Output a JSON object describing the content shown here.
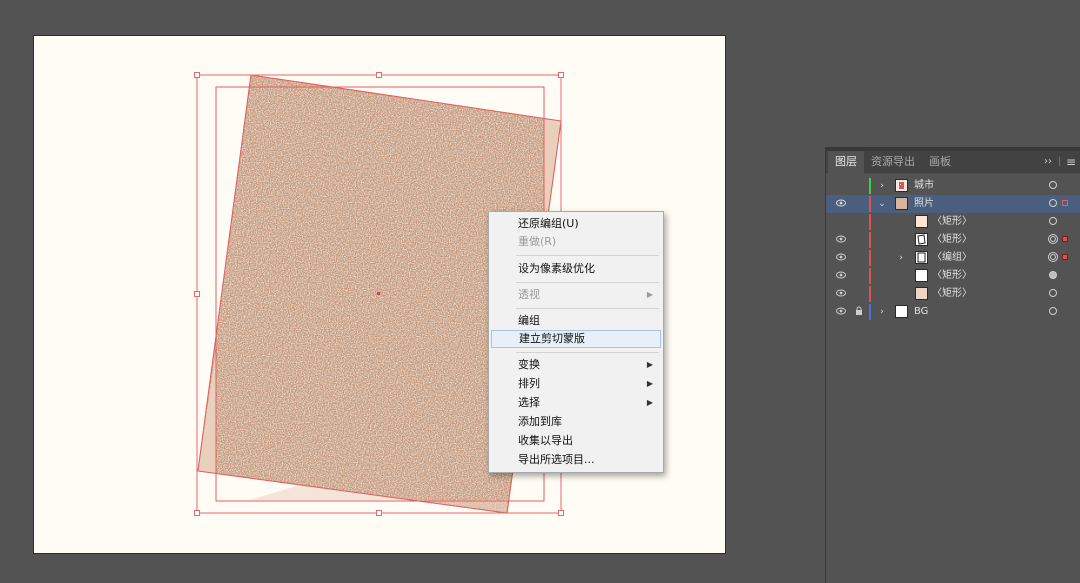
{
  "context_menu": {
    "items": [
      {
        "label": "还原编组(U)",
        "disabled": false,
        "submenu": false
      },
      {
        "label": "重做(R)",
        "disabled": true,
        "submenu": false
      },
      {
        "label": "设为像素级优化",
        "disabled": false,
        "submenu": false
      },
      {
        "label": "透视",
        "disabled": true,
        "submenu": true
      },
      {
        "label": "编组",
        "disabled": false,
        "submenu": false
      },
      {
        "label": "建立剪切蒙版",
        "disabled": false,
        "submenu": false,
        "highlight": true
      },
      {
        "label": "变换",
        "disabled": false,
        "submenu": true
      },
      {
        "label": "排列",
        "disabled": false,
        "submenu": true
      },
      {
        "label": "选择",
        "disabled": false,
        "submenu": true
      },
      {
        "label": "添加到库",
        "disabled": false,
        "submenu": false
      },
      {
        "label": "收集以导出",
        "disabled": false,
        "submenu": false
      },
      {
        "label": "导出所选项目...",
        "disabled": false,
        "submenu": false
      }
    ],
    "submenu_arrow": "▶"
  },
  "layers_panel": {
    "tabs": [
      {
        "label": "图层",
        "active": true
      },
      {
        "label": "资源导出",
        "active": false
      },
      {
        "label": "画板",
        "active": false
      }
    ],
    "collapse_icon": "››",
    "menu_icon": "≡",
    "rows": [
      {
        "label": "城市",
        "visible": false,
        "locked": false,
        "color": "#3fcf4a",
        "expander": "›",
        "level": 0,
        "thumb": "city",
        "target": "single",
        "selmark": ""
      },
      {
        "label": "照片",
        "visible": true,
        "locked": false,
        "color": "#e05252",
        "expander": "⌄",
        "level": 0,
        "thumb": "photo",
        "selected": true,
        "target": "single",
        "selmark": "hollow"
      },
      {
        "label": "〈矩形〉",
        "visible": false,
        "locked": false,
        "color": "#e05252",
        "expander": "",
        "level": 1,
        "thumb": "peach",
        "target": "single",
        "selmark": ""
      },
      {
        "label": "〈矩形〉",
        "visible": true,
        "locked": false,
        "color": "#e05252",
        "expander": "",
        "level": 1,
        "thumb": "blob",
        "target": "double",
        "selmark": "filled"
      },
      {
        "label": "〈编组〉",
        "visible": true,
        "locked": false,
        "color": "#e05252",
        "expander": "›",
        "level": 1,
        "thumb": "group",
        "target": "double",
        "selmark": "filled"
      },
      {
        "label": "〈矩形〉",
        "visible": true,
        "locked": false,
        "color": "#e05252",
        "expander": "",
        "level": 1,
        "thumb": "white",
        "target": "filled",
        "selmark": ""
      },
      {
        "label": "〈矩形〉",
        "visible": true,
        "locked": false,
        "color": "#e05252",
        "expander": "",
        "level": 1,
        "thumb": "beige",
        "target": "single",
        "selmark": ""
      },
      {
        "label": "BG",
        "visible": true,
        "locked": true,
        "color": "#4a6fd8",
        "expander": "›",
        "level": 0,
        "thumb": "white",
        "target": "single",
        "selmark": ""
      }
    ]
  }
}
